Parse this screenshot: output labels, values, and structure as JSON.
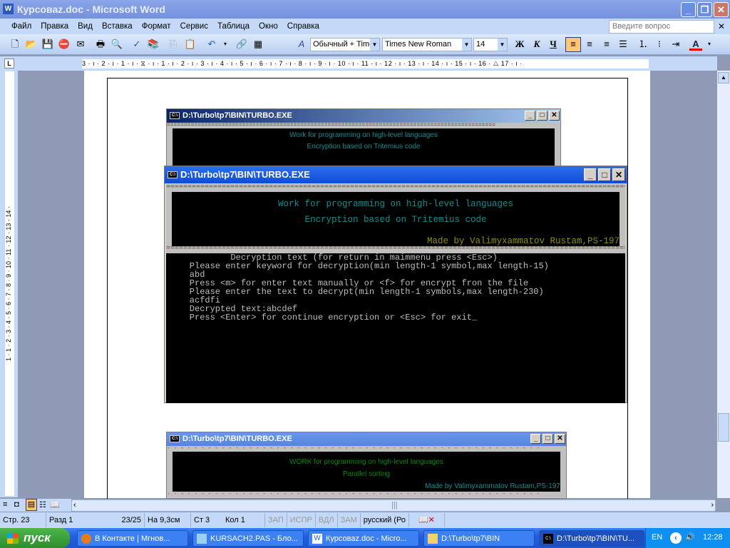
{
  "window": {
    "title": "Курсоваz.doc - Microsoft Word",
    "minimize": "_",
    "restore": "❐",
    "close": "✕"
  },
  "menu": [
    "Файл",
    "Правка",
    "Вид",
    "Вставка",
    "Формат",
    "Сервис",
    "Таблица",
    "Окно",
    "Справка"
  ],
  "ask": {
    "placeholder": "Введите вопрос",
    "close": "✕"
  },
  "format": {
    "style": "Обычный + Time",
    "font": "Times New Roman",
    "size": "14",
    "bold": "Ж",
    "italic": "К",
    "underline": "Ч",
    "font_color": "A"
  },
  "ruler": {
    "h": "3 · ı · 2 · ı · 1 · ı · ⧖ · ı · 1 · ı · 2 · ı · 3 · ı · 4 · ı · 5 · ı · 6 · ı · 7 · ı · 8 · ı · 9 · ı · 10 · ı · 11 · ı · 12 · ı · 13 · ı · 14 · ı · 15 · ı · 16 · △ 17 · ı ·",
    "v": "1 · 1 · 2 · 3 · 4 · 5 · 6 · 7 · 8 · 9 · 10 · 11 · 12 · 13 · 14 ·"
  },
  "console_top": {
    "title": "D:\\Turbo\\tp7\\BIN\\TURBO.EXE",
    "line1": "Work for programming on high-level languages",
    "line2": "Encryption based on Tritemius code"
  },
  "console_main": {
    "title": "D:\\Turbo\\tp7\\BIN\\TURBO.EXE",
    "line1": "Work for programming on high-level languages",
    "line2": "Encryption based on Tritemius code",
    "author": "Made by Valimyxammatov Rustam,PS-197",
    "lines": [
      "            Decryption text (for return in maimmenu press <Esc>)",
      "    Please enter keyword for decryption(min length-1 symbol,max length-15)",
      "    abd",
      "    Press <m> for enter text manually or <f> for encrypt fron the file",
      "    Please enter the text to decrypt(min length-1 symbols,max length-230)",
      "    acfdfi",
      "    Decrypted text:abcdef",
      "    Press <Enter> for continue encryption or <Esc> for exit_"
    ]
  },
  "console_bottom": {
    "title": "D:\\Turbo\\tp7\\BIN\\TURBO.EXE",
    "line1": "WORK for programming on high-level languages",
    "line2": "Parallel sorting",
    "author": "Made by Valimyxammatov Rustam,PS-197"
  },
  "status": {
    "page": "Стр. 23",
    "section": "Разд 1",
    "pages": "23/25",
    "at": "На 9,3см",
    "line": "Ст 3",
    "col": "Кол 1",
    "rec": "ЗАП",
    "trk": "ИСПР",
    "ext": "ВДЛ",
    "ovr": "ЗАМ",
    "lang": "русский (Ро"
  },
  "taskbar": {
    "start": "пуск",
    "tasks": [
      "В Контакте | Мгнов...",
      "KURSACH2.PAS - Бло...",
      "Курсоваz.doc - Micro...",
      "D:\\Turbo\\tp7\\BIN",
      "D:\\Turbo\\tp7\\BIN\\TU..."
    ],
    "lang": "EN",
    "clock": "12:28"
  }
}
